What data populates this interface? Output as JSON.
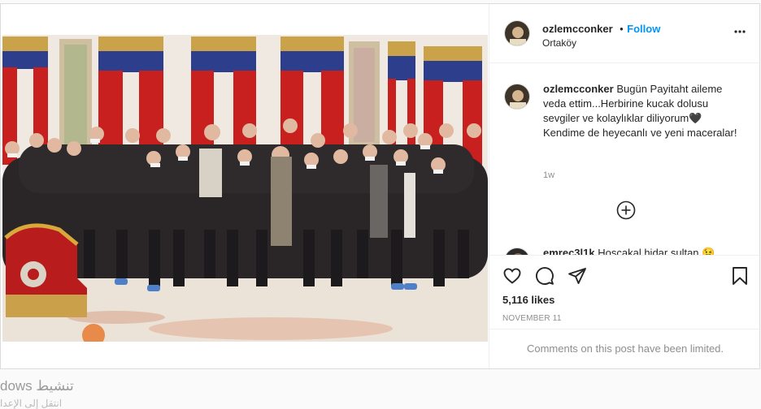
{
  "post": {
    "username": "ozlemcconker",
    "location": "Ortaköy",
    "follow_separator": "•",
    "follow_label": "Follow",
    "caption_user": "ozlemcconker",
    "caption_text": "Bugün Payitaht aileme veda ettim...Herbirine kucak dolusu sevgiler ve kolaylıklar diliyorum🖤 Kendime de heyecanlı ve yeni maceralar!",
    "caption_age": "1w",
    "second_comment_user": "emrec3l1k",
    "second_comment_text": "Hoşçakal hidar sultan 😉",
    "likes": "5,116 likes",
    "date": "NOVEMBER 11",
    "comments_limited": "Comments on this post have been limited.",
    "icons": [
      "more-options-icon",
      "load-more-comments-icon",
      "like-heart-icon",
      "comment-icon",
      "share-icon",
      "save-bookmark-icon"
    ]
  },
  "overlay": {
    "watermark_line1": "dows  تنشيط",
    "watermark_line2": "انتقل إلى الإعدا"
  },
  "colors": {
    "link": "#0095f6",
    "text": "#262626",
    "muted": "#8e8e8e",
    "border": "#dbdbdb"
  }
}
